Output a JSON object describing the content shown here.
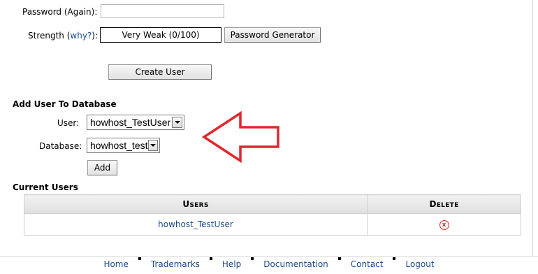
{
  "password_again": {
    "label": "Password (Again):",
    "value": ""
  },
  "strength": {
    "label": "Strength (",
    "why_link": "why?",
    "label_close": "):",
    "value": "Very Weak (0/100)"
  },
  "buttons": {
    "password_generator": "Password Generator",
    "create_user": "Create User",
    "add": "Add"
  },
  "add_user_section": {
    "title": "Add User To Database",
    "user_label": "User:",
    "user_selected": "howhost_TestUser",
    "database_label": "Database:",
    "database_selected": "howhost_test"
  },
  "current_users": {
    "title": "Current Users",
    "columns": {
      "users_first": "U",
      "users_rest": "SERS",
      "delete_first": "D",
      "delete_rest": "ELETE"
    },
    "rows": [
      {
        "user": "howhost_TestUser",
        "delete_icon": "delete-x-icon"
      }
    ]
  },
  "footer": [
    "Home",
    "Trademarks",
    "Help",
    "Documentation",
    "Contact",
    "Logout"
  ],
  "colors": {
    "link": "#1a4b8c",
    "arrow": "#e1262b"
  }
}
